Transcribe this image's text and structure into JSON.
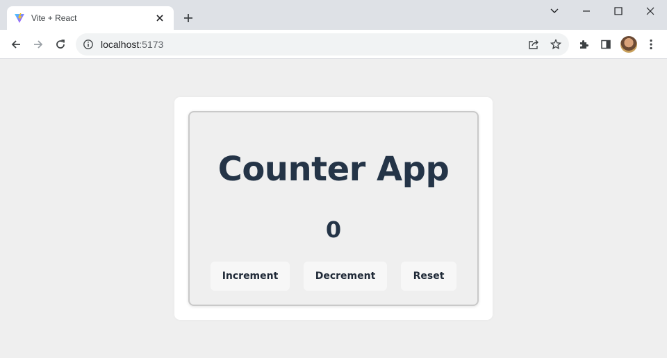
{
  "browser": {
    "tab": {
      "title": "Vite + React",
      "favicon": "vite-logo"
    },
    "omnibox": {
      "host": "localhost",
      "port": ":5173"
    }
  },
  "app": {
    "title": "Counter App",
    "count": "0",
    "buttons": {
      "increment": "Increment",
      "decrement": "Decrement",
      "reset": "Reset"
    }
  },
  "colors": {
    "title_text": "#243447",
    "page_bg": "#efefef",
    "card_bg": "#ffffff",
    "button_bg": "#f7f7f7"
  }
}
